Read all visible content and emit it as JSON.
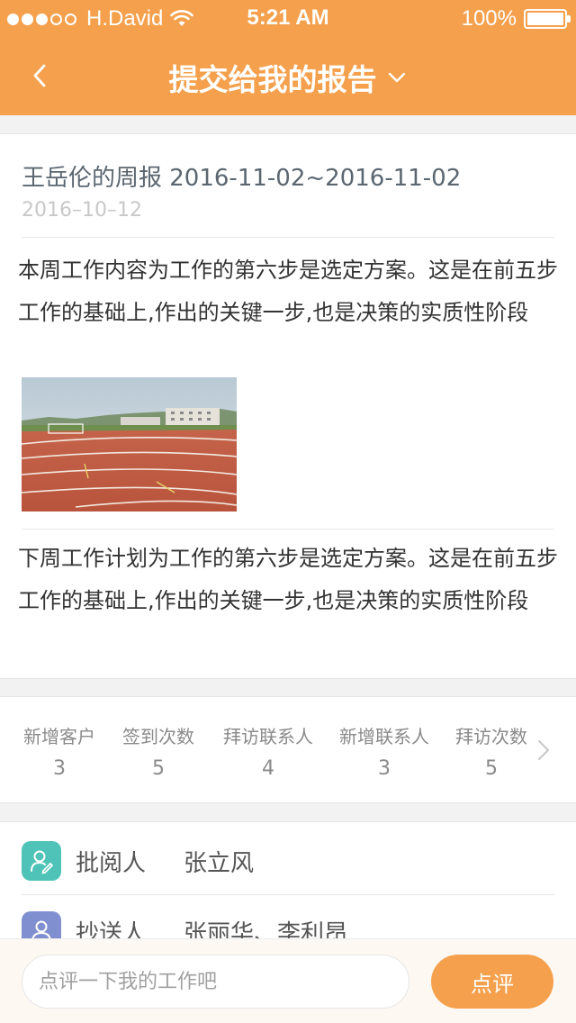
{
  "status_bar": {
    "carrier": "H.David",
    "time": "5:21 AM",
    "battery": "100%",
    "signal_bars_filled": 3,
    "signal_bars_total": 5
  },
  "nav": {
    "title": "提交给我的报告",
    "back_icon": "chevron-left-icon",
    "dropdown_icon": "chevron-down-icon"
  },
  "report": {
    "title": "王岳伦的周报 2016-11-02~2016-11-02",
    "date": "2016–10–12",
    "this_week": "本周工作内容为工作的第六步是选定方案。这是在前五步工作的基础上,作出的关键一步,也是决策的实质性阶段",
    "next_week": "下周工作计划为工作的第六步是选定方案。这是在前五步工作的基础上,作出的关键一步,也是决策的实质性阶段"
  },
  "stats": [
    {
      "label": "新增客户",
      "value": "3"
    },
    {
      "label": "签到次数",
      "value": "5"
    },
    {
      "label": "拜访联系人",
      "value": "4"
    },
    {
      "label": "新增联系人",
      "value": "3"
    },
    {
      "label": "拜访次数",
      "value": "5"
    }
  ],
  "people": {
    "reviewer": {
      "label": "批阅人",
      "names": "张立风",
      "icon": "reviewer-edit-icon"
    },
    "cc": {
      "label": "抄送人",
      "names": "张丽华、李利昂",
      "icon": "person-icon"
    }
  },
  "comment": {
    "placeholder": "点评一下我的工作吧",
    "button": "点评"
  },
  "colors": {
    "brand": "#f5a04c",
    "reviewer_icon": "#4fc3b8",
    "cc_icon": "#7f8fcf"
  }
}
